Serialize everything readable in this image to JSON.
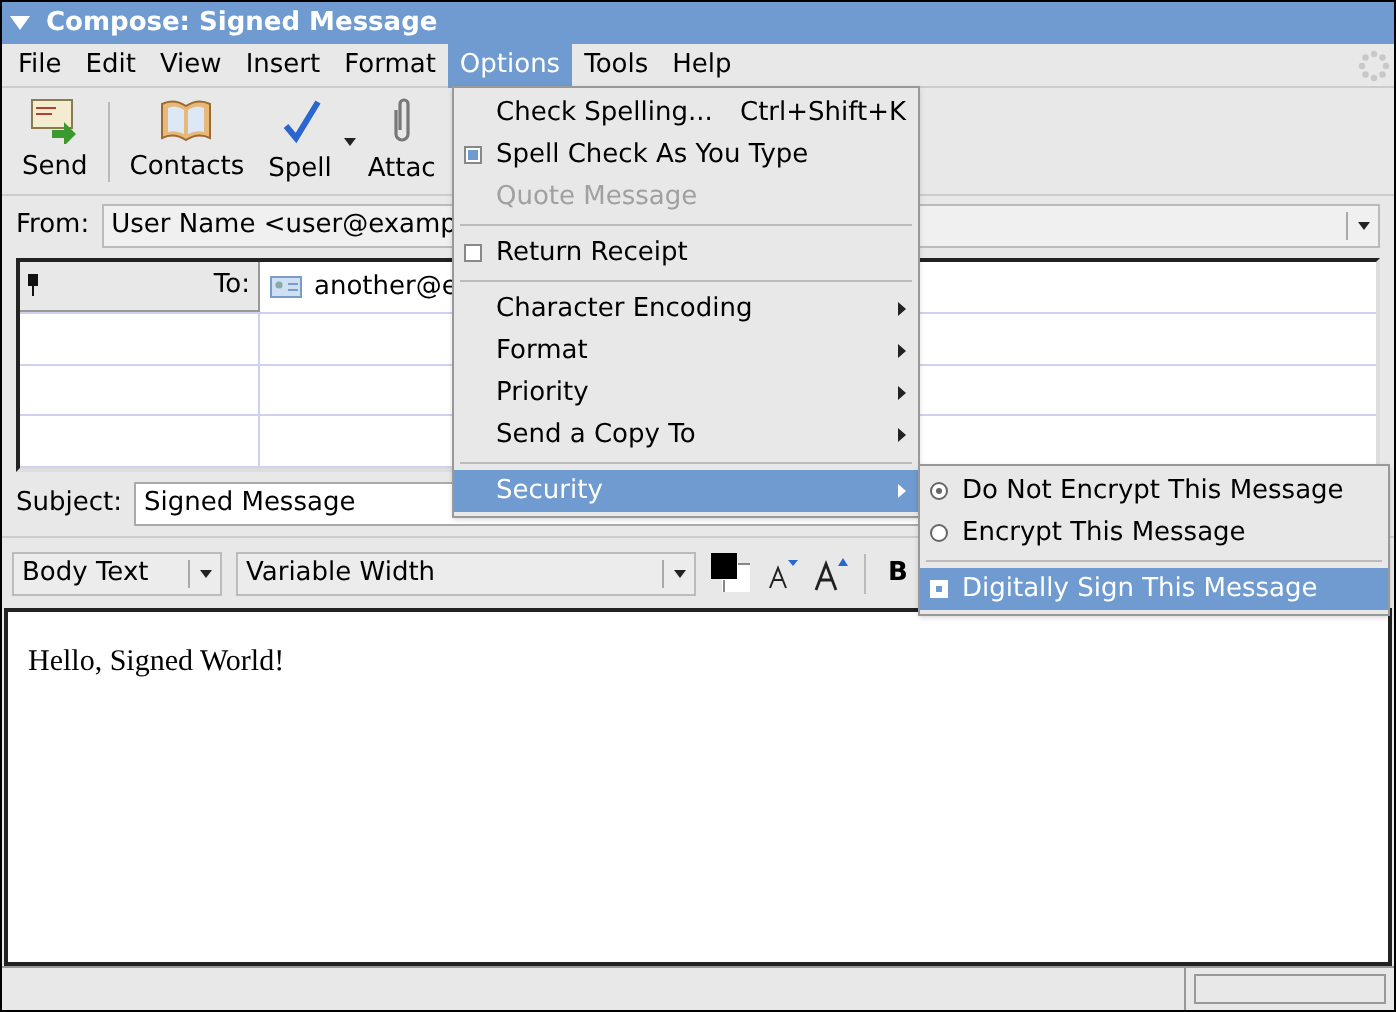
{
  "window": {
    "title": "Compose: Signed Message"
  },
  "menubar": [
    {
      "label": "File",
      "selected": false
    },
    {
      "label": "Edit",
      "selected": false
    },
    {
      "label": "View",
      "selected": false
    },
    {
      "label": "Insert",
      "selected": false
    },
    {
      "label": "Format",
      "selected": false
    },
    {
      "label": "Options",
      "selected": true
    },
    {
      "label": "Tools",
      "selected": false
    },
    {
      "label": "Help",
      "selected": false
    }
  ],
  "toolbar": [
    {
      "label": "Send",
      "kind": "send"
    },
    {
      "label": "Contacts",
      "kind": "contacts"
    },
    {
      "label": "Spell",
      "kind": "spell"
    },
    {
      "label": "Attac",
      "kind": "attach"
    }
  ],
  "from": {
    "label": "From:",
    "value": "User Name <user@examp"
  },
  "recipients": [
    {
      "type": "To:",
      "address": "another@e"
    }
  ],
  "subject": {
    "label": "Subject:",
    "value": "Signed Message"
  },
  "format_bar": {
    "paragraph": "Body Text",
    "font": "Variable Width",
    "bold": "B"
  },
  "body": {
    "text": "Hello, Signed World!"
  },
  "status_bar": {
    "progress": {
      "level": 0
    }
  },
  "options_menu": [
    {
      "kind": "item",
      "label": "Check Spelling...",
      "shortcut": "Ctrl+Shift+K",
      "disabled": false
    },
    {
      "kind": "check",
      "label": "Spell Check As You Type",
      "checked": true,
      "disabled": false
    },
    {
      "kind": "item",
      "label": "Quote Message",
      "disabled": true
    },
    {
      "kind": "separator"
    },
    {
      "kind": "check",
      "label": "Return Receipt",
      "checked": false,
      "disabled": false
    },
    {
      "kind": "separator"
    },
    {
      "kind": "submenu",
      "label": "Character Encoding",
      "selected": false
    },
    {
      "kind": "submenu",
      "label": "Format",
      "selected": false
    },
    {
      "kind": "submenu",
      "label": "Priority",
      "selected": false
    },
    {
      "kind": "submenu",
      "label": "Send a Copy To",
      "selected": false
    },
    {
      "kind": "separator"
    },
    {
      "kind": "submenu",
      "label": "Security",
      "selected": true
    }
  ],
  "security_menu": [
    {
      "kind": "radio",
      "label": "Do Not Encrypt This Message",
      "checked": true,
      "selected": false
    },
    {
      "kind": "radio",
      "label": "Encrypt This Message",
      "checked": false,
      "selected": false
    },
    {
      "kind": "separator"
    },
    {
      "kind": "check",
      "label": "Digitally Sign This Message",
      "checked": true,
      "selected": true
    }
  ]
}
